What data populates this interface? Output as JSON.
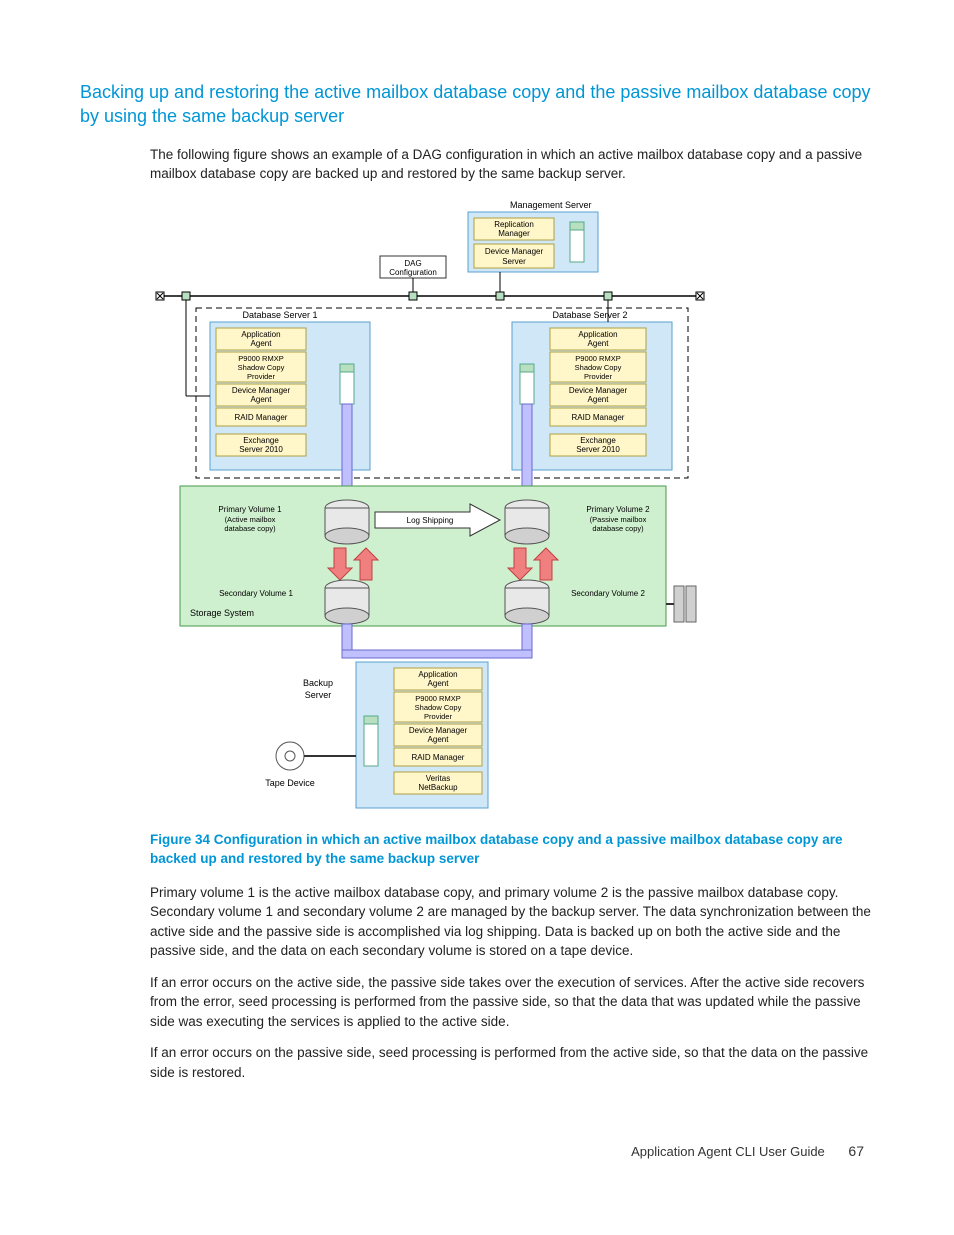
{
  "section_title": "Backing up and restoring the active mailbox database copy and the passive mailbox database copy by using the same backup server",
  "intro": "The following figure shows an example of a DAG configuration in which an active mailbox database copy and a passive mailbox database copy are backed up and restored by the same backup server.",
  "caption": "Figure 34 Configuration in which an active mailbox database copy and a passive mailbox database copy are backed up and restored by the same backup server",
  "para1": "Primary volume 1 is the active mailbox database copy, and primary volume 2 is the passive mailbox database copy. Secondary volume 1 and secondary volume 2 are managed by the backup server. The data synchronization between the active side and the passive side is accomplished via log shipping. Data is backed up on both the active side and the passive side, and the data on each secondary volume is stored on a tape device.",
  "para2": "If an error occurs on the active side, the passive side takes over the execution of services. After the active side recovers from the error, seed processing is performed from the passive side, so that the data that was updated while the passive side was executing the services is applied to the active side.",
  "para3": "If an error occurs on the passive side, seed processing is performed from the active side, so that the data on the passive side is restored.",
  "footer": {
    "doc_title": "Application Agent CLI User Guide",
    "page_no": "67"
  },
  "diagram": {
    "management_server": "Management Server",
    "replication_manager": "Replication Manager",
    "device_manager_server": "Device Manager Server",
    "dag_configuration": "DAG Configuration",
    "db_server_1": "Database Server 1",
    "db_server_2": "Database Server 2",
    "application_agent": "Application Agent",
    "p9000_rmxp": "P9000 RMXP Shadow Copy Provider",
    "device_manager_agent": "Device Manager Agent",
    "raid_manager": "RAID Manager",
    "exchange_server": "Exchange Server 2010",
    "primary_volume_1": "Primary Volume 1 (Active mailbox database copy)",
    "primary_volume_2": "Primary Volume 2 (Passive mailbox database copy)",
    "log_shipping": "Log Shipping",
    "secondary_volume_1": "Secondary Volume 1",
    "secondary_volume_2": "Secondary Volume 2",
    "storage_system": "Storage System",
    "backup_server": "Backup Server",
    "tape_device": "Tape Device",
    "veritas_netbackup": "Veritas NetBackup"
  }
}
